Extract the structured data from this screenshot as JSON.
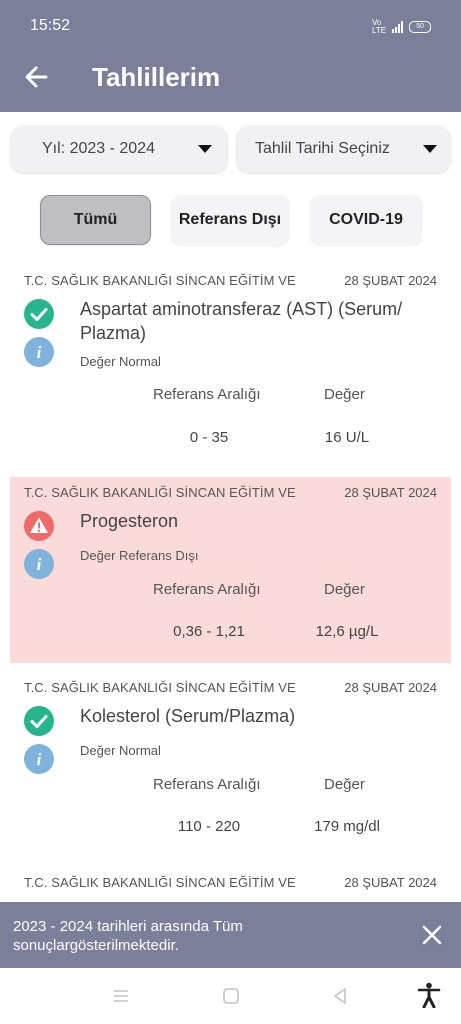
{
  "status_bar": {
    "time": "15:52",
    "network_label": "Vo LTE",
    "battery": "50"
  },
  "app_bar": {
    "title": "Tahlillerim",
    "back_icon": "arrow-left-icon"
  },
  "filters": {
    "year_dropdown": "Yıl: 2023 - 2024",
    "date_dropdown": "Tahlil Tarihi Seçiniz",
    "buttons": [
      {
        "label": "Tümü",
        "selected": true
      },
      {
        "label": "Referans Dışı",
        "selected": false
      },
      {
        "label": "COVID-19",
        "selected": false
      }
    ]
  },
  "results": [
    {
      "hospital": "T.C. SAĞLIK BAKANLIĞI SİNCAN EĞİTİM VE",
      "date": "28 ŞUBAT 2024",
      "name": "Aspartat aminotransferaz (AST) (Serum/ Plazma)",
      "status_text": "Değer Normal",
      "status": "normal",
      "ref_label": "Referans Aralığı",
      "value_label": "Değer",
      "ref_range": "0 - 35",
      "value": "16 U/L"
    },
    {
      "hospital": "T.C. SAĞLIK BAKANLIĞI SİNCAN EĞİTİM VE",
      "date": "28 ŞUBAT 2024",
      "name": "Progesteron",
      "status_text": "Değer Referans Dışı",
      "status": "abnormal",
      "ref_label": "Referans Aralığı",
      "value_label": "Değer",
      "ref_range": "0,36 - 1,21",
      "value": "12,6 µg/L"
    },
    {
      "hospital": "T.C. SAĞLIK BAKANLIĞI SİNCAN EĞİTİM VE",
      "date": "28 ŞUBAT 2024",
      "name": "Kolesterol (Serum/Plazma)",
      "status_text": "Değer Normal",
      "status": "normal",
      "ref_label": "Referans Aralığı",
      "value_label": "Değer",
      "ref_range": "110 - 220",
      "value": "179 mg/dl"
    },
    {
      "hospital": "T.C. SAĞLIK BAKANLIĞI SİNCAN EĞİTİM VE",
      "date": "28 ŞUBAT 2024"
    }
  ],
  "snackbar": {
    "message": "2023 - 2024 tarihleri arasında Tüm sonuçlargösterilmektedir.",
    "close_icon": "close-icon"
  },
  "colors": {
    "primary": "#7c7f99",
    "normal_green": "#27b58e",
    "warning_red": "#f06a6a",
    "info_blue": "#7fb3dc",
    "abnormal_bg": "#fbdada"
  }
}
